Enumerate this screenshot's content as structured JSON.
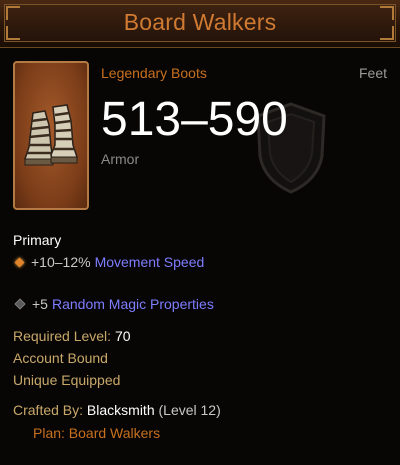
{
  "item": {
    "name": "Board Walkers",
    "type": "Legendary Boots",
    "slot": "Feet",
    "armor_value": "513–590",
    "armor_label": "Armor",
    "icon": "boots-icon"
  },
  "stats": {
    "primary_label": "Primary",
    "primary_affix": {
      "value": "+10–12%",
      "stat": "Movement Speed"
    },
    "magic_affix": {
      "value": "+5",
      "stat": "Random Magic Properties"
    }
  },
  "requirements": {
    "level_label": "Required Level:",
    "level_value": "70",
    "account_bound": "Account Bound",
    "unique_equipped": "Unique Equipped"
  },
  "crafting": {
    "crafted_by_label": "Crafted By:",
    "crafter": "Blacksmith",
    "crafter_level": "(Level 12)",
    "plan": "Plan: Board Walkers"
  },
  "colors": {
    "legendary": "#c8701e",
    "magic_stat": "#7d7dff",
    "header_bg": "#2a1609"
  }
}
